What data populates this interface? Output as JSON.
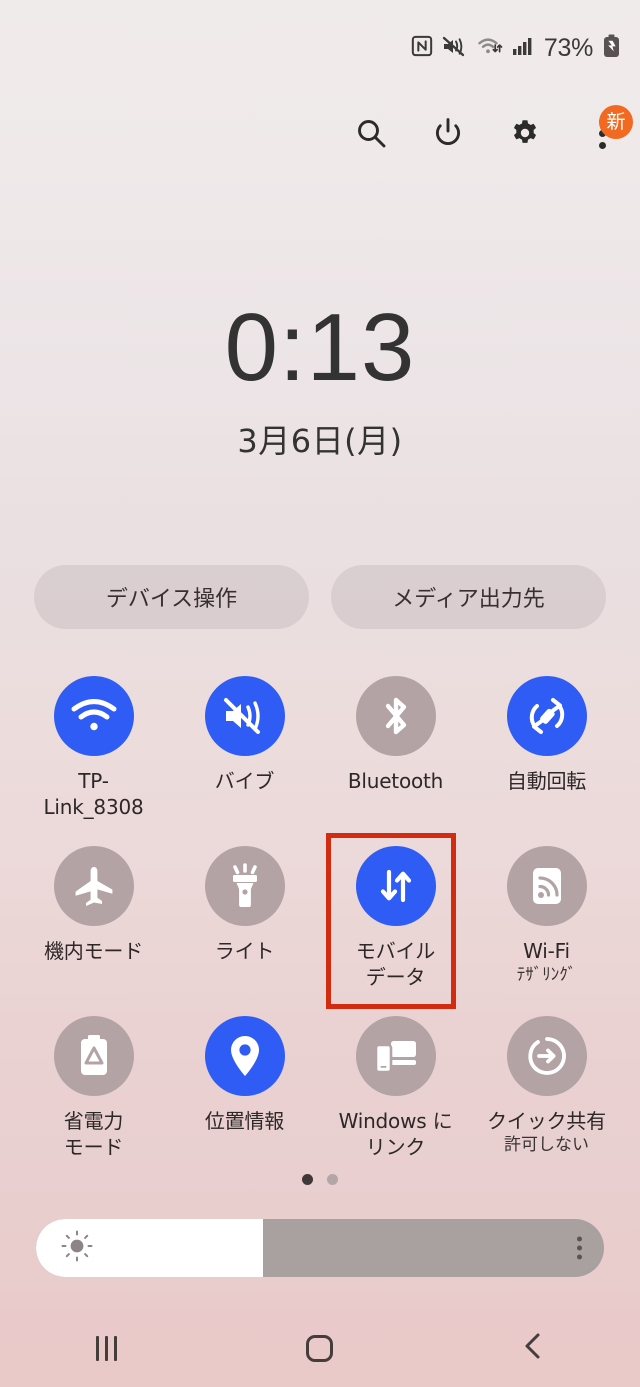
{
  "status_bar": {
    "icons": [
      "nfc-icon",
      "mute-vibrate-icon",
      "wifi-icon",
      "signal-icon"
    ],
    "battery_percent": "73%",
    "battery_icon": "battery-charging-icon"
  },
  "header": {
    "search_label": "search-icon",
    "power_label": "power-icon",
    "settings_label": "gear-icon",
    "menu_label": "kebab-menu-icon",
    "badge_text": "新"
  },
  "clock": {
    "time": "0:13",
    "date": "3月6日(月)"
  },
  "pills": [
    {
      "label": "デバイス操作",
      "name": "device-control-button"
    },
    {
      "label": "メディア出力先",
      "name": "media-output-button"
    }
  ],
  "tiles": [
    {
      "name": "tile-wifi",
      "icon": "wifi-icon",
      "label": "TP-\nLink_8308",
      "sub": "",
      "state": "on"
    },
    {
      "name": "tile-vibrate",
      "icon": "vibrate-icon",
      "label": "バイブ",
      "sub": "",
      "state": "on"
    },
    {
      "name": "tile-bluetooth",
      "icon": "bluetooth-icon",
      "label": "Bluetooth",
      "sub": "",
      "state": "off"
    },
    {
      "name": "tile-auto-rotate",
      "icon": "auto-rotate-icon",
      "label": "自動回転",
      "sub": "",
      "state": "on"
    },
    {
      "name": "tile-airplane-mode",
      "icon": "airplane-icon",
      "label": "機内モード",
      "sub": "",
      "state": "off"
    },
    {
      "name": "tile-flashlight",
      "icon": "flashlight-icon",
      "label": "ライト",
      "sub": "",
      "state": "off"
    },
    {
      "name": "tile-mobile-data",
      "icon": "mobile-data-icon",
      "label": "モバイル\nデータ",
      "sub": "",
      "state": "on",
      "highlighted": true
    },
    {
      "name": "tile-wifi-tethering",
      "icon": "wifi-tethering-icon",
      "label": "Wi-Fi",
      "sub": "ﾃｻﾞﾘﾝｸﾞ",
      "state": "off"
    },
    {
      "name": "tile-power-saving",
      "icon": "battery-saver-icon",
      "label": "省電力\nモード",
      "sub": "",
      "state": "off"
    },
    {
      "name": "tile-location",
      "icon": "location-pin-icon",
      "label": "位置情報",
      "sub": "",
      "state": "on"
    },
    {
      "name": "tile-link-to-windows",
      "icon": "link-to-windows-icon",
      "label": "Windows に\nリンク",
      "sub": "",
      "state": "off"
    },
    {
      "name": "tile-quick-share",
      "icon": "quick-share-icon",
      "label": "クイック共有",
      "sub": "許可しない",
      "state": "off"
    }
  ],
  "pager": {
    "total": 2,
    "active_index": 0
  },
  "brightness": {
    "value_percent": 40,
    "icon": "brightness-sun-icon",
    "menu": "kebab-menu-icon"
  },
  "navbar": [
    {
      "name": "nav-recents-button",
      "icon": "recents-icon"
    },
    {
      "name": "nav-home-button",
      "icon": "home-icon"
    },
    {
      "name": "nav-back-button",
      "icon": "back-chevron-icon"
    }
  ],
  "colors": {
    "accent_blue": "#2f5cf5",
    "inactive_gray": "#b3a3a4",
    "highlight_red": "#d32b10",
    "badge_orange": "#f26a21"
  }
}
